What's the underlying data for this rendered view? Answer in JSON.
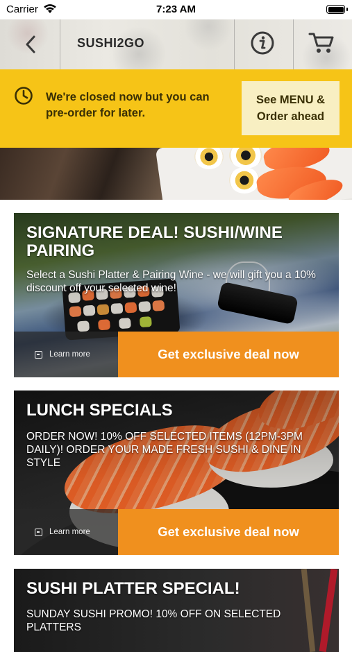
{
  "status_bar": {
    "carrier": "Carrier",
    "time": "7:23 AM"
  },
  "nav": {
    "title": "SUSHI2GO"
  },
  "closed_banner": {
    "message": "We're closed now but you can pre-order for later.",
    "button_label": "See MENU & Order ahead"
  },
  "cards": [
    {
      "title": "SIGNATURE DEAL! SUSHI/WINE PAIRING",
      "description": "Select a Sushi Platter & Pairing Wine - we will gift you a 10% discount off your selected wine!",
      "learn_more": "Learn more",
      "cta": "Get exclusive deal now"
    },
    {
      "title": "LUNCH SPECIALS",
      "description": "ORDER NOW! 10% OFF SELECTED ITEMS (12PM-3PM DAILY)! ORDER YOUR MADE FRESH SUSHI & DINE IN STYLE",
      "learn_more": "Learn more",
      "cta": "Get exclusive deal now"
    },
    {
      "title": "SUSHI PLATTER SPECIAL!",
      "description": "SUNDAY SUSHI PROMO! 10% OFF ON SELECTED PLATTERS"
    }
  ],
  "colors": {
    "banner": "#f6c417",
    "cta": "#f0901e"
  }
}
